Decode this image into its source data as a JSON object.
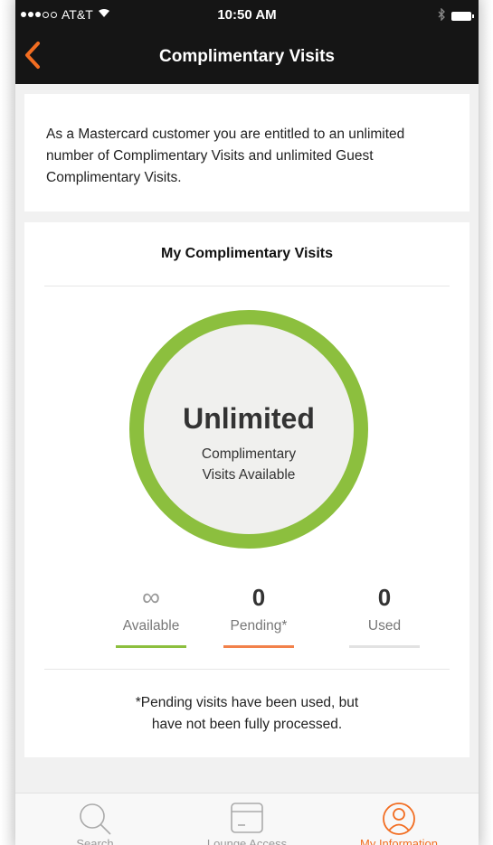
{
  "status_bar": {
    "carrier": "AT&T",
    "time": "10:50 AM"
  },
  "nav": {
    "title": "Complimentary Visits"
  },
  "info": {
    "text": "As a Mastercard customer you are entitled to an unlimited number of Complimentary Visits and unlimited Guest Complimentary Visits."
  },
  "visits": {
    "section_title": "My Complimentary Visits",
    "ring_main": "Unlimited",
    "ring_sub_line1": "Complimentary",
    "ring_sub_line2": "Visits Available",
    "ring_color": "#8cbf3e",
    "stats": [
      {
        "value": "∞",
        "label": "Available",
        "bar_color": "#8cbf3e"
      },
      {
        "value": "0",
        "label": "Pending*",
        "bar_color": "#f2814a"
      },
      {
        "value": "0",
        "label": "Used",
        "bar_color": "#e2e2e2"
      }
    ],
    "footnote_line1": "*Pending visits have been used, but",
    "footnote_line2": "have not been fully processed."
  },
  "tabs": [
    {
      "label": "Search",
      "icon": "search-icon",
      "active": false
    },
    {
      "label": "Lounge Access",
      "icon": "card-icon",
      "active": false
    },
    {
      "label": "My Information",
      "icon": "user-icon",
      "active": true
    }
  ],
  "colors": {
    "accent": "#f26d21",
    "header_bg": "#151515"
  }
}
